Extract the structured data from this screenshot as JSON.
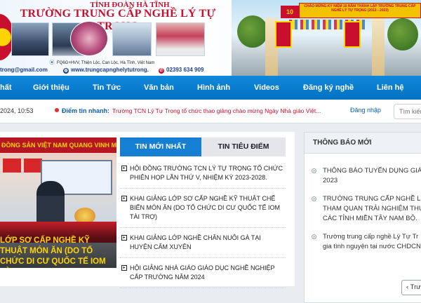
{
  "banner": {
    "org": "TỈNH ĐOÀN HÀ TĨNH",
    "school": "TRƯỜNG TRUNG CẤP NGHỀ LÝ TỰ TRỌNG",
    "address": "FQ6G+HVV, Thiện Lộc, Can Lộc, Hà Tĩnh, Việt Nam",
    "email": "trong@gmail.com",
    "website": "www.trungcapnghelytutrong.",
    "phone": "02393 634 909",
    "gate_title": "CHÀO MỪNG KỶ NIỆM 10 NĂM THÀNH LẬP TRƯỜNG TRUNG CẤP NGHỀ LÝ TỰ TRỌNG (2013 - 2023)",
    "gate_tag": "10"
  },
  "nav": {
    "items": [
      "hất",
      "Giới thiệu",
      "Tin Tức",
      "Văn bản",
      "Hình ảnh",
      "Videos",
      "Đăng ký nghề",
      "Liên hệ"
    ]
  },
  "ticker": {
    "date": "2024, 10:53",
    "label": "Điểm tin nhanh:",
    "text": "Trường TCN Lý Tự Trọng tổ chức thao giảng chào mừng Ngày Nhà giáo Việt...",
    "login": "Đăng nhập",
    "search_placeholder": "Tìm kiếm"
  },
  "featured": {
    "banner": "ĐỒNG SẢN VIỆT NAM QUANG VINH MUÔN NĂM",
    "caption": "LỚP SƠ CẤP NGHỀ KỸ THUẬT MÓN ĂN (DO TỔ CHỨC DI CƯ QUỐC TẾ IOM TÀI TRỢ)"
  },
  "tabs": [
    "TIN MỚI NHẤT",
    "TIN TIÊU ĐIỂM"
  ],
  "news": [
    "HỘI ĐỒNG TRƯỜNG TCN LÝ TỰ TRỌNG TỔ CHỨC PHIÊN HỌP LẦN THỨ V, NHIỆM KỲ 2023-2028.",
    "KHAI GIẢNG LỚP SƠ CẤP NGHỀ KỸ THUẬT CHẾ BIẾN MÓN ĂN (DO TỔ CHỨC DI CƯ QUỐC TẾ IOM TÀI TRỢ)",
    "KHAI GIẢNG LỚP NGHỀ CHĂN NUÔI GÀ TẠI HUYỆN CẨM XUYÊN",
    "HỘI GIẢNG NHÀ GIÁO GIÁO DỤC NGHỀ NGHIỆP CẤP TRƯỜNG NĂM 2024"
  ],
  "sidebar": {
    "title": "THÔNG BÁO MỚI",
    "items": [
      [
        "THÔNG BÁO TUYỂN DỤNG GIÁO",
        "2023"
      ],
      [
        "TRƯỜNG TRUNG CẤP NGHỀ LÝ T",
        "THAM QUAN TRẢI NGHIỆM THỰ",
        "CÁC TỈNH MIỀN TÂY NAM BỘ."
      ],
      [
        "Trường trung cấp nghề Lý Tự Tr",
        "gia tình nguyện tại nước CHDCN"
      ]
    ],
    "button": "Trư"
  }
}
